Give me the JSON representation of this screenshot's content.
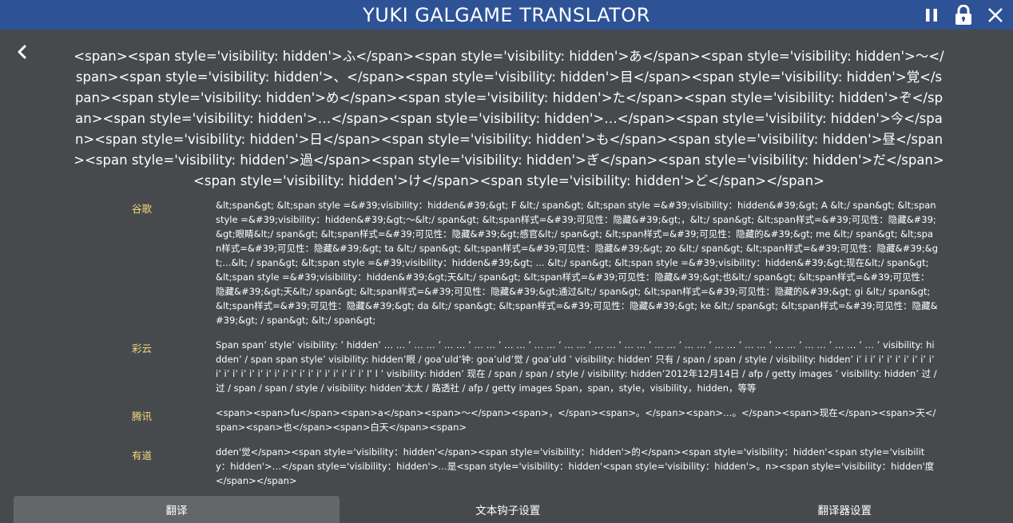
{
  "window": {
    "title": "YUKI GALGAME TRANSLATOR"
  },
  "source_text": "<span><span style='visibility: hidden'>ふ</span><span style='visibility: hidden'>あ</span><span style='visibility: hidden'>～</span><span style='visibility: hidden'>、</span><span style='visibility: hidden'>目</span><span style='visibility: hidden'>覚</span><span style='visibility: hidden'>め</span><span style='visibility: hidden'>た</span><span style='visibility: hidden'>ぞ</span><span style='visibility: hidden'>…</span><span style='visibility: hidden'>…</span><span style='visibility: hidden'>今</span><span style='visibility: hidden'>日</span><span style='visibility: hidden'>も</span><span style='visibility: hidden'>昼</span><span style='visibility: hidden'>過</span><span style='visibility: hidden'>ぎ</span><span style='visibility: hidden'>だ</span><span style='visibility: hidden'>け</span><span style='visibility: hidden'>ど</span></span>",
  "translations": [
    {
      "name": "谷歌",
      "text": "&lt;span&gt; &lt;span style =&#39;visibility：hidden&#39;&gt; F &lt;/ span&gt; &lt;span style =&#39;visibility：hidden&#39;&gt; A &lt;/ span&gt; &lt;span style =&#39;visibility：hidden&#39;&gt;～&lt;/ span&gt; &lt;span样式=&#39;可见性：隐藏&#39;&gt;，&lt;/ span&gt; &lt;span样式=&#39;可见性：隐藏&#39;&gt;眼睛&lt;/ span&gt; &lt;span样式=&#39;可见性：隐藏&#39;&gt;感官&lt;/ span&gt; &lt;span样式=&#39;可见性：隐藏的&#39;&gt; me &lt;/ span&gt; &lt;span样式=&#39;可见性：隐藏&#39;&gt; ta &lt;/ span&gt; &lt;span样式=&#39;可见性：隐藏&#39;&gt; zo &lt;/ span&gt; &lt;span样式=&#39;可见性：隐藏&#39;&gt;...&lt; / span&gt; &lt;span style =&#39;visibility：hidden&#39;&gt; ... &lt;/ span&gt; &lt;span style =&#39;visibility：hidden&#39;&gt;现在&lt;/ span&gt; &lt;span style =&#39;visibility：hidden&#39;&gt;天&lt;/ span&gt; &lt;span样式=&#39;可见性：隐藏&#39;&gt;也&lt;/ span&gt; &lt;span样式=&#39;可见性：隐藏&#39;&gt;天&lt;/ span&gt; &lt;span样式=&#39;可见性：隐藏&#39;&gt;通过&lt;/ span&gt; &lt;span样式=&#39;可见性：隐藏的&#39;&gt; gi &lt;/ span&gt; &lt;span样式=&#39;可见性：隐藏&#39;&gt; da &lt;/ span&gt; &lt;span样式=&#39;可见性：隐藏&#39;&gt; ke &lt;/ span&gt; &lt;span样式=&#39;可见性：隐藏&#39;&gt; / span&gt; &lt;/ span&gt;"
    },
    {
      "name": "彩云",
      "text": "Span span’ style’ visibility: ’ hidden’ … … ’ … … ’ … … ’ … … ’ … … ’ … … ’ … … ’ … … ’ … … ’ … … ’ … … ’ … … ’ … … ’ … … ’ … … ’ … … ’ … ’ visibility: hidden’ / span span style’ visibility: hidden’眼 / goa’uld’钟: goa’uld’觉 / goa’uld ’ visibility: hidden’ 只有 / span / span / style / visibility: hidden’ i’ i i’ i’ i’ i’ i’ i’ i’ i’ i’ i’ i’ i’ i’ i’ i’ i’ i’ i’ i’ i’ i’ i’ i’ i’ i’ i’ l’ l ’ visibility: hidden’ 现在 / span / span / style / visibility: hidden’2012年12月14日 / afp / getty images ’ visibility: hidden’ 过 / 过 / span / span / style / visibility: hidden’太太 / 路透社 / afp / getty images Span，span，style，visibility，hidden，等等"
    },
    {
      "name": "腾讯",
      "text": "<span><span>fu</span><span>a</span><span>～</span><span>，</span><span>。</span><span>…。</span><span>现在</span><span>天</span><span>也</span><span>白天</span><span>"
    },
    {
      "name": "有道",
      "text": "dden'觉</span><span style='visibility：hidden'</span><span style='visibility：hidden'>的</span><span style='visibility：hidden'<span style='visibility：hidden'>…</span style='visibility：hidden'>…是<span style='visibility：hidden'<span style='visibility：hidden'>。n><span style='visibility：hidden'度</span></span>"
    }
  ],
  "tabs": [
    {
      "label": "翻译",
      "active": true
    },
    {
      "label": "文本钩子设置",
      "active": false
    },
    {
      "label": "翻译器设置",
      "active": false
    }
  ],
  "colors": {
    "titlebar": "#2d5296",
    "background": "#474a4d",
    "translator_name": "#f5d97a",
    "active_tab": "#64676a"
  },
  "icons": {
    "pause": "pause-icon",
    "lock": "lock-icon",
    "close": "close-icon",
    "back": "chevron-left-icon"
  }
}
